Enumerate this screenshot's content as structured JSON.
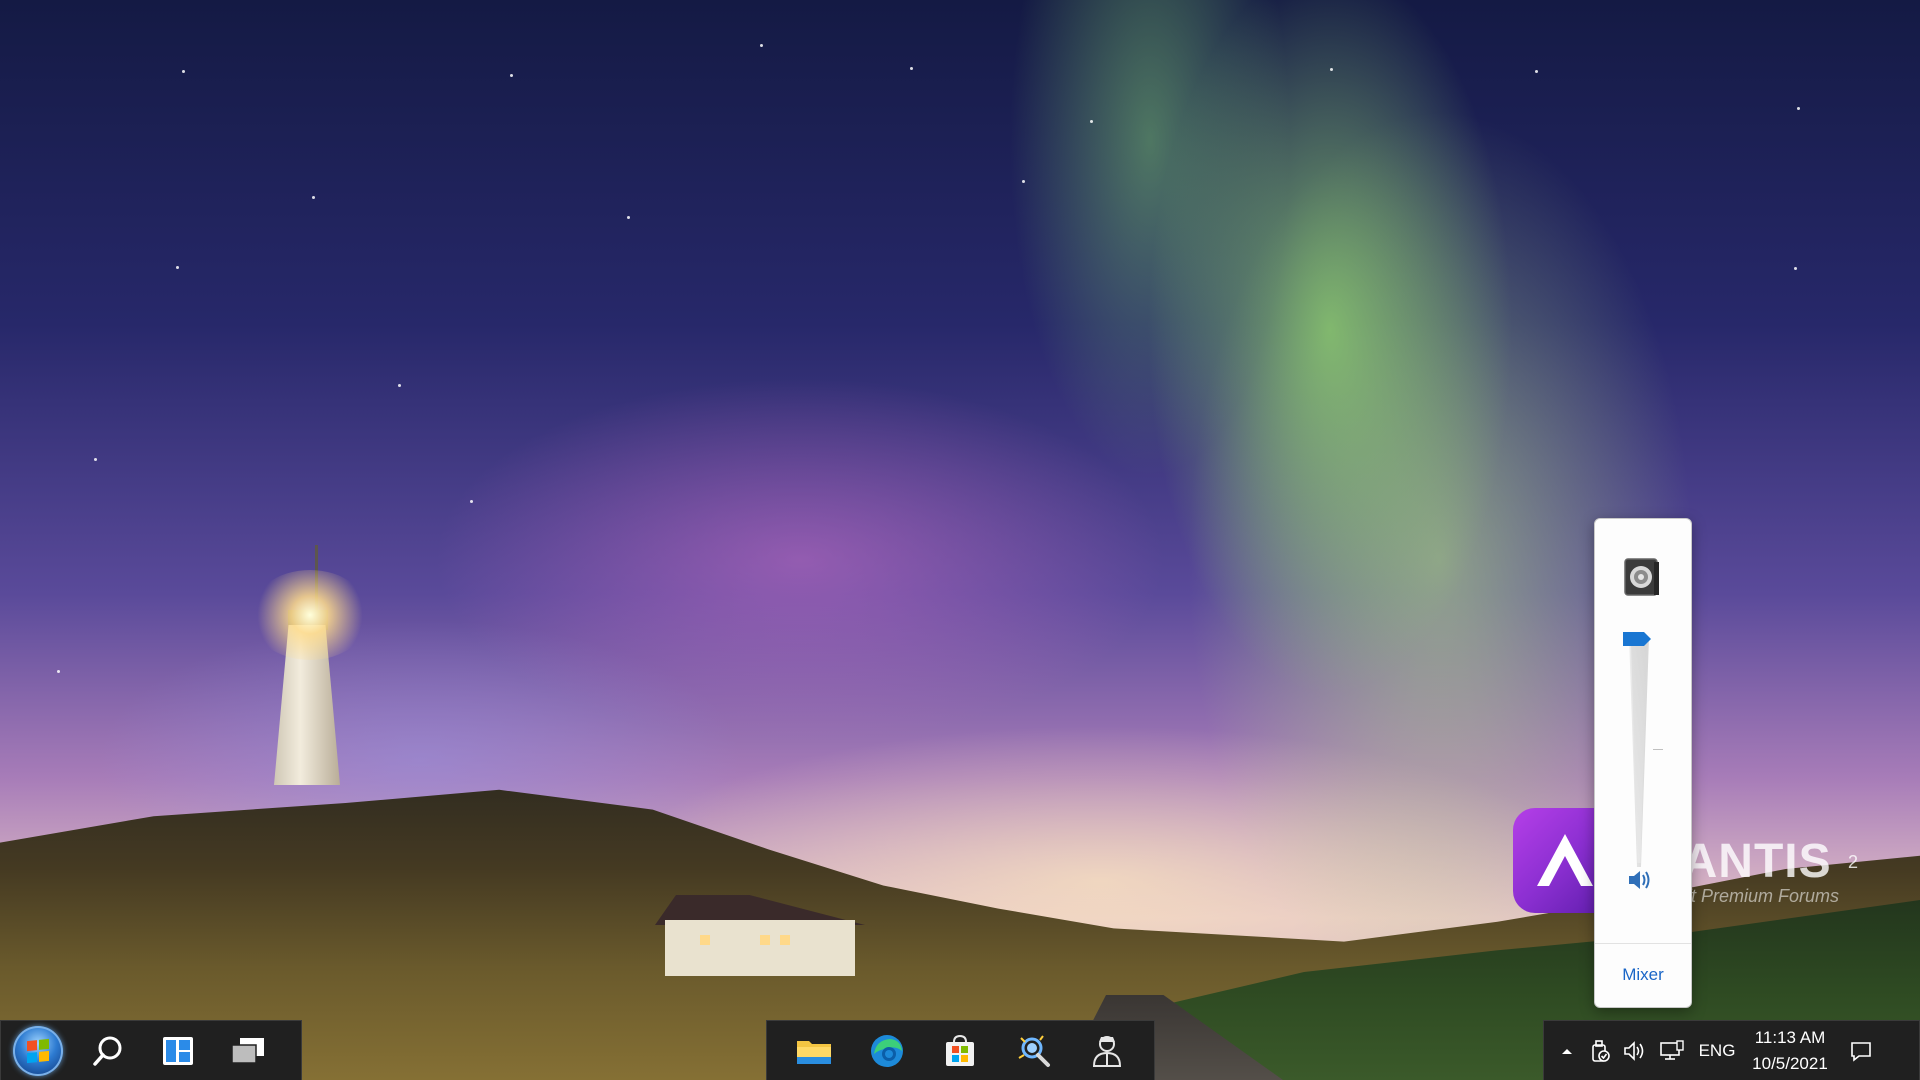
{
  "taskbar": {
    "left": [
      {
        "name": "start-button",
        "icon": "windows-7-start-orb-icon"
      },
      {
        "name": "search-button",
        "icon": "search-icon"
      },
      {
        "name": "widgets-button",
        "icon": "widgets-icon"
      },
      {
        "name": "task-view-button",
        "icon": "task-view-icon"
      }
    ],
    "pinned_apps": [
      {
        "name": "file-explorer",
        "icon": "folder-icon"
      },
      {
        "name": "microsoft-edge",
        "icon": "edge-icon"
      },
      {
        "name": "microsoft-store",
        "icon": "store-icon"
      },
      {
        "name": "magnifier-tool",
        "icon": "magnifier-icon"
      },
      {
        "name": "user-app",
        "icon": "agent-icon"
      }
    ],
    "tray": {
      "language": "ENG",
      "time": "11:13 AM",
      "date": "10/5/2021",
      "icons": [
        "chevron-up-icon",
        "security-icon",
        "speaker-icon",
        "network-icon",
        "notification-icon"
      ]
    }
  },
  "volume_flyout": {
    "device_icon": "speaker-device-icon",
    "volume_level": 1.0,
    "mute_icon": "speaker-volume-icon",
    "mixer_label": "Mixer"
  },
  "watermark": {
    "name": "TLANTIS",
    "superscript": "2",
    "tagline": "Minecraft Premium Forums"
  },
  "colors": {
    "taskbar_bg": "#202020",
    "accent": "#1976d2",
    "mixer_link": "#1a66c7",
    "watermark_logo": "#8b2fd1"
  }
}
